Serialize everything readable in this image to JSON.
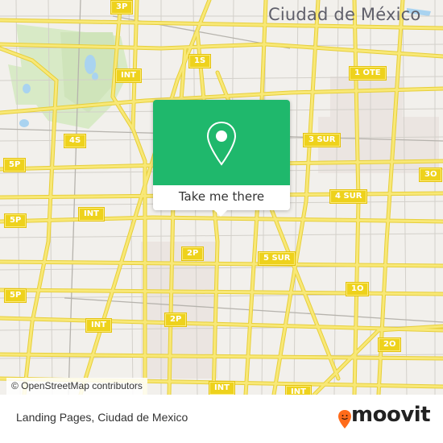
{
  "map": {
    "city_label": "Ciudad de México",
    "colors": {
      "background": "#f2f0ec",
      "road": "#f6e36a",
      "road_casing": "#e7cf3a",
      "park": "#d8eac6",
      "water": "#a9d3f0",
      "dense_area": "#ebe5e1",
      "minor_road": "#c9c6c0",
      "accent_green": "#1fb86c",
      "brand_orange": "#ff6b1a"
    },
    "shields": [
      {
        "label": "3P"
      },
      {
        "label": "1S"
      },
      {
        "label": "INT"
      },
      {
        "label": "1 OTE"
      },
      {
        "label": "4S"
      },
      {
        "label": "3 SUR"
      },
      {
        "label": "5P"
      },
      {
        "label": "3O"
      },
      {
        "label": "4 SUR"
      },
      {
        "label": "INT"
      },
      {
        "label": "5P"
      },
      {
        "label": "2P"
      },
      {
        "label": "5 SUR"
      },
      {
        "label": "1O"
      },
      {
        "label": "5P"
      },
      {
        "label": "INT"
      },
      {
        "label": "2P"
      },
      {
        "label": "2O"
      },
      {
        "label": "INT"
      },
      {
        "label": "INT"
      }
    ],
    "attribution": "© OpenStreetMap contributors"
  },
  "popup": {
    "icon": "map-pin-icon",
    "button_label": "Take me there"
  },
  "footer": {
    "title": "Landing Pages, Ciudad de Mexico",
    "brand": "moovit",
    "brand_icon": "moovit-smiley-pin-icon"
  }
}
